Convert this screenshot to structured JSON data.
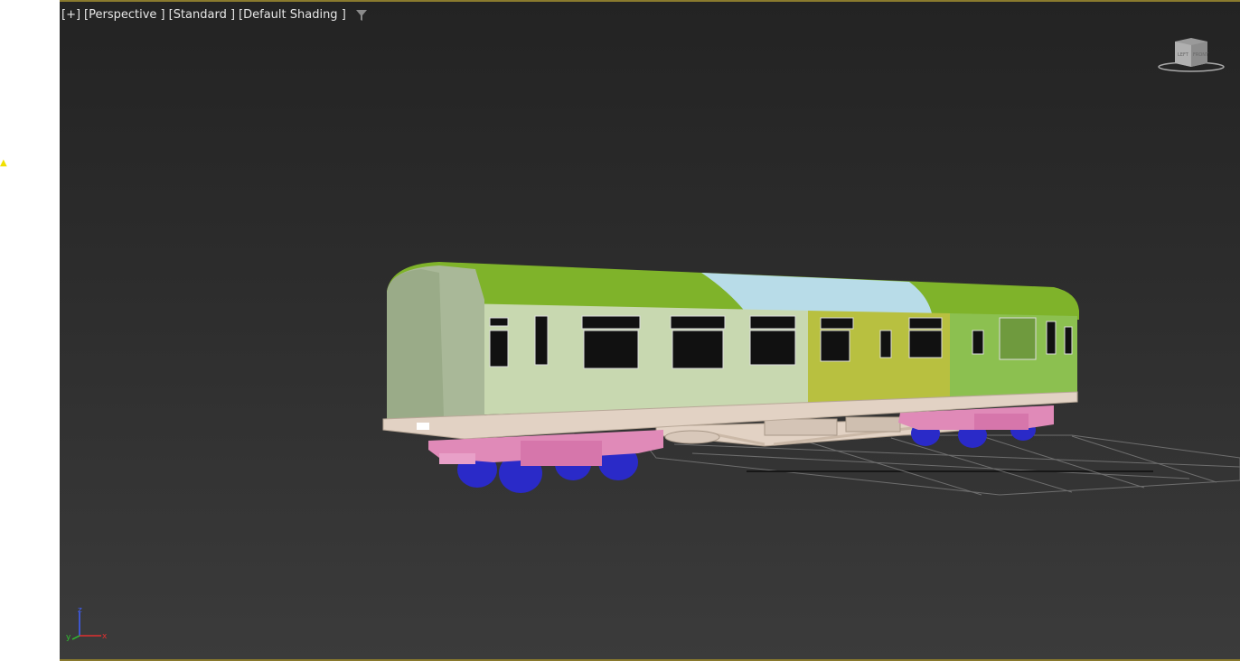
{
  "viewport": {
    "menu_plus": "[+]",
    "menu_view": "[Perspective ]",
    "menu_mode": "[Standard ]",
    "menu_shading": "[Default Shading ]",
    "filter_icon": "filter-funnel-icon",
    "viewcube_icon": "viewcube-icon",
    "viewcube_face_left": "LEFT",
    "viewcube_face_front": "FRONT",
    "axis_z": "z",
    "axis_y": "y",
    "axis_x": "x"
  },
  "colors": {
    "viewport_bg": "#2c2c2c",
    "roof_green": "#7fb32a",
    "body_pale": "#c8d8b0",
    "body_yellow": "#b8c040",
    "body_green": "#8cc050",
    "roof_blue": "#b8dce8",
    "chassis": "#e0cdbf",
    "bogie_pink": "#e08ab8",
    "wheel_blue": "#2a2ac8",
    "grid": "#8a8a8a"
  }
}
